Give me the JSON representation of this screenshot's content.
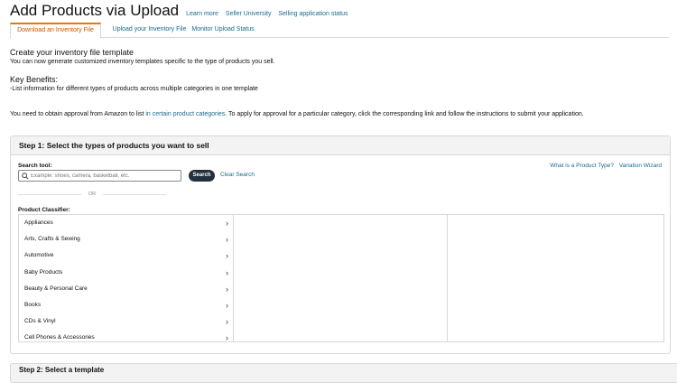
{
  "header": {
    "title": "Add Products via Upload",
    "links": [
      "Learn more",
      "Seller University",
      "Selling application status"
    ]
  },
  "tabs": [
    {
      "label": "Download an Inventory File",
      "active": true
    },
    {
      "label": "Upload your Inventory File",
      "active": false
    },
    {
      "label": "Monitor Upload Status",
      "active": false
    }
  ],
  "intro": {
    "title": "Create your inventory file template",
    "text": "You can now generate customized inventory templates specific to the type of products you sell.",
    "benefits_title": "Key Benefits:",
    "benefits_text": "-List information for different types of products across multiple categories in one template",
    "approval_pre": "You need to obtain approval from Amazon to list ",
    "approval_link": "in certain product categories",
    "approval_post": ". To apply for approval for a particular category, click the corresponding link and follow the instructions to submit your application."
  },
  "step1": {
    "title": "Step 1: Select the types of products you want to sell",
    "search_label": "Search tool:",
    "search_placeholder": "Example: shoes, camera, basketball, etc.",
    "search_value": "",
    "search_button": "Search",
    "clear_link": "Clear Search",
    "or_text": "OR",
    "what_link": "What is a Product Type?",
    "variation_link": "Variation Wizard",
    "classifier_label": "Product Classifier:",
    "categories": [
      "Appliances",
      "Arts, Crafts & Sewing",
      "Automotive",
      "Baby Products",
      "Beauty & Personal Care",
      "Books",
      "CDs & Vinyl",
      "Cell Phones & Accessories"
    ]
  },
  "step2": {
    "title": "Step 2: Select a template"
  },
  "colors": {
    "link": "#1a6a8a",
    "active_tab": "#c45500",
    "button_bg": "#232f3e"
  }
}
